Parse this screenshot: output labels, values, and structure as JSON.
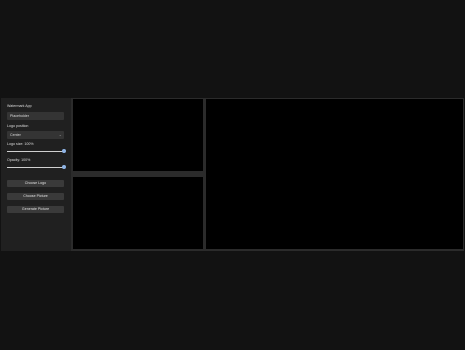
{
  "app": {
    "title": "Watermark App"
  },
  "sidebar": {
    "name_field": {
      "value": "Placeholder"
    },
    "logo_position": {
      "label": "Logo position",
      "value": "Center",
      "chevron": "chevron-down-icon"
    },
    "logo_size": {
      "label": "Logo size: 100%",
      "percent": 100
    },
    "opacity": {
      "label": "Opacity: 100%",
      "percent": 100
    },
    "buttons": {
      "choose_logo": "Choose Logo",
      "choose_picture": "Choose Picture",
      "generate_picture": "Generate Picture"
    }
  },
  "colors": {
    "background": "#121212",
    "sidebar": "#202020",
    "panel": "#000000",
    "slider_thumb": "#8fb4e6"
  }
}
